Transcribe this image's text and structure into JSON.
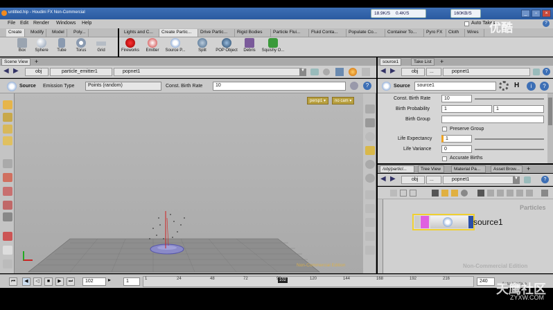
{
  "window": {
    "title": "untitled.hip - Houdini FX Non-Commercial",
    "net_down": "18.9K/S",
    "net_up": "0.4K/S",
    "net_speed": "160KB/S",
    "watermark_top": "优酷",
    "watermark_bottom": "ZYXW.COM",
    "watermark_brand": "天鹰社区"
  },
  "menu": [
    "File",
    "Edit",
    "Render",
    "Windows",
    "Help"
  ],
  "auto_takes": "Auto Takes",
  "shelf_left_tabs": [
    "Create",
    "Modify",
    "Model",
    "Poly..."
  ],
  "shelf_right_tabs": [
    "Lights and C...",
    "Create Partic...",
    "Drive Partic...",
    "Rigid Bodies",
    "Particle Flui...",
    "Fluid Conta...",
    "Populate Co...",
    "Container To...",
    "Pyro FX",
    "Cloth",
    "Wires"
  ],
  "shelf_left_tools": [
    "Box",
    "Sphere",
    "Tube",
    "Torus",
    "Grid"
  ],
  "shelf_right_tools": [
    "Fireworks",
    "Emitter",
    "Source P...",
    "Split",
    "POP Object",
    "Debris",
    "Squishy O..."
  ],
  "scene": {
    "tab": "Scene View",
    "path_obj": "obj",
    "path_emitter": "particle_emitter1",
    "path_popnet": "popnet1",
    "tool_label": "Source",
    "emission_label": "Emission Type",
    "emission_value": "Points (random)",
    "birth_label": "Const. Birth Rate",
    "birth_value": "10",
    "camera": "persp1 ▾",
    "cam2": "no cam ▾",
    "watermark": "Non-Commercial Edition"
  },
  "params": {
    "tabs": [
      "source1",
      "Take List"
    ],
    "path_obj": "obj",
    "path_mid": "...",
    "path_popnet": "popnet1",
    "node_type": "Source",
    "node_name": "source1",
    "const_birth_rate_label": "Const. Birth Rate",
    "const_birth_rate": "10",
    "birth_prob_label": "Birth Probability",
    "birth_prob_1": "1",
    "birth_prob_2": "1",
    "birth_group_label": "Birth Group",
    "birth_group": "",
    "preserve_group": "Preserve Group",
    "life_expectancy_label": "Life Expectancy",
    "life_expectancy": "1",
    "life_variance_label": "Life Variance",
    "life_variance": "0",
    "accurate_births": "Accurate Births"
  },
  "network": {
    "tabs": [
      "/obj/particl...",
      "Tree View",
      "Material Pa...",
      "Asset Brow..."
    ],
    "path_obj": "obj",
    "path_mid": "...",
    "path_popnet": "popnet1",
    "context_label": "Particles",
    "node_label": "source1",
    "watermark": "Non-Commercial Edition"
  },
  "timeline": {
    "frame": "102",
    "start": "1",
    "current": "102",
    "end": "240",
    "auto_update": "Auto Update",
    "ticks": [
      "1",
      "24",
      "48",
      "72",
      "96",
      "120",
      "144",
      "168",
      "192",
      "216"
    ]
  },
  "colors": {
    "accent": "#3d6fb5",
    "node_pink": "#e060e0",
    "node_blue": "#2a4fa8",
    "selection": "#f0d030",
    "particle_red": "#d02020"
  }
}
